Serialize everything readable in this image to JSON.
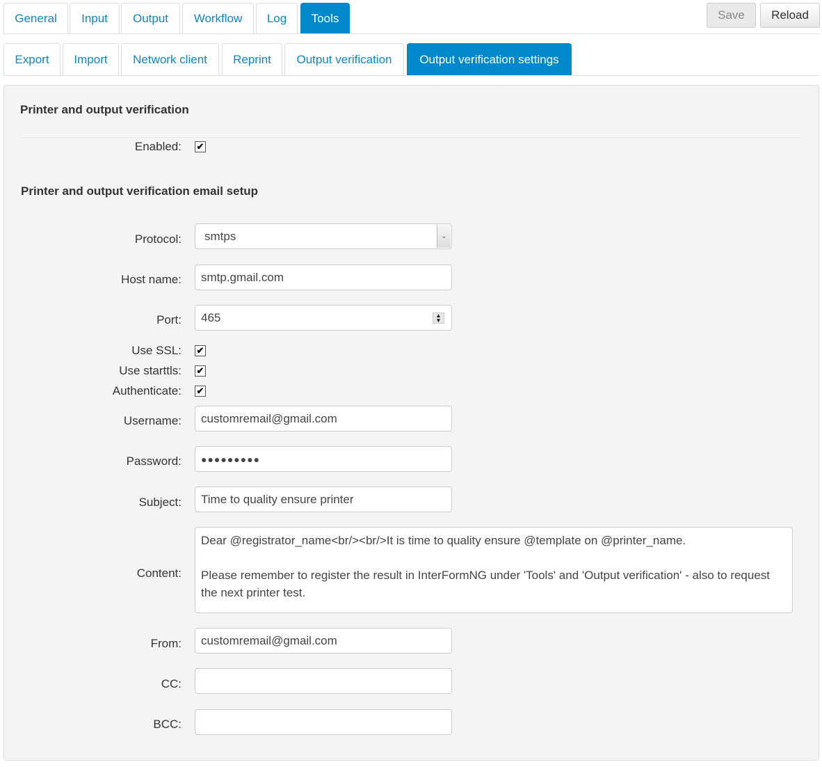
{
  "top_tabs": [
    "General",
    "Input",
    "Output",
    "Workflow",
    "Log",
    "Tools"
  ],
  "active_top_tab": "Tools",
  "toolbar": {
    "save": "Save",
    "reload": "Reload"
  },
  "sub_tabs": [
    "Export",
    "Import",
    "Network client",
    "Reprint",
    "Output verification",
    "Output verification settings"
  ],
  "active_sub_tab": "Output verification settings",
  "section1": {
    "title": "Printer and output verification",
    "enabled_label": "Enabled:",
    "enabled": true
  },
  "section2": {
    "title": "Printer and output verification email setup",
    "protocol_label": "Protocol:",
    "protocol": "smtps",
    "host_label": "Host name:",
    "host": "smtp.gmail.com",
    "port_label": "Port:",
    "port": "465",
    "ssl_label": "Use SSL:",
    "ssl": true,
    "starttls_label": "Use starttls:",
    "starttls": true,
    "auth_label": "Authenticate:",
    "auth": true,
    "username_label": "Username:",
    "username": "customremail@gmail.com",
    "password_label": "Password:",
    "password": "●●●●●●●●●",
    "subject_label": "Subject:",
    "subject": "Time to quality ensure printer",
    "content_label": "Content:",
    "content": "Dear @registrator_name<br/><br/>It is time to quality ensure @template on @printer_name.\n\nPlease remember to register the result in InterFormNG under 'Tools' and 'Output verification' - also to request the next printer test.",
    "from_label": "From:",
    "from": "customremail@gmail.com",
    "cc_label": "CC:",
    "cc": "",
    "bcc_label": "BCC:",
    "bcc": ""
  },
  "colors": {
    "accent": "#0088cc",
    "panel": "#f4f4f4"
  }
}
